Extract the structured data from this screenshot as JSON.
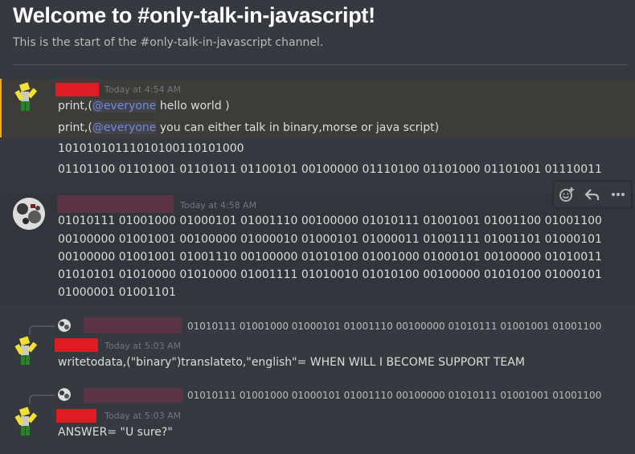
{
  "channel": {
    "welcome_title": "Welcome to #only-talk-in-javascript!",
    "welcome_subtitle": "This is the start of the #only-talk-in-javascript channel."
  },
  "messages": [
    {
      "timestamp": "Today at 4:54 AM",
      "lines": [
        {
          "pre": "print,(",
          "mention": "@everyone",
          "post": " hello world )"
        },
        {
          "pre": "print,(",
          "mention": "@everyone",
          "post": " you can either talk in binary,morse  or java script)"
        },
        {
          "text": "10101010111010100110101000"
        },
        {
          "text": "01101100 01101001 01101011 01100101 00100000 01110100 01101000 01101001 01110011"
        }
      ],
      "highlight_color": "#faa61a",
      "name_redaction_color": "#e01b24"
    },
    {
      "timestamp": "Today at 4:58 AM",
      "lines": [
        "01010111 01001000 01000101 01001110 00100000 01010111 01001001 01001100 01001100",
        "00100000 01001001 00100000 01000010 01000101 01000011 01001111 01001101 01000101",
        "00100000 01001001 01001110 00100000 01010100 01001000 01000101 00100000 01010011",
        "01010101 01010000 01010000 01001111 01010010 01010100 00100000 01010100 01000101",
        "01000001 01001101"
      ],
      "name_redaction_color": "#5a3346"
    },
    {
      "reply_preview": "01010111 01001000 01000101 01001110 00100000 01010111 01001001 01001100 010...",
      "timestamp": "Today at 5:03 AM",
      "text": "writetodata,(\"binary\")translateto,\"english\"= WHEN WILL I BECOME SUPPORT TEAM"
    },
    {
      "reply_preview": "01010111 01001000 01000101 01001110 00100000 01010111 01001001 01001100 010...",
      "timestamp": "Today at 5:03 AM",
      "text": "ANSWER= \"U sure?\""
    }
  ],
  "toolbar": {
    "icons": [
      "add-reaction-icon",
      "reply-icon",
      "more-icon"
    ]
  },
  "colors": {
    "background": "#36393f",
    "hover_background": "#32353b",
    "mention_text": "#7289da"
  }
}
